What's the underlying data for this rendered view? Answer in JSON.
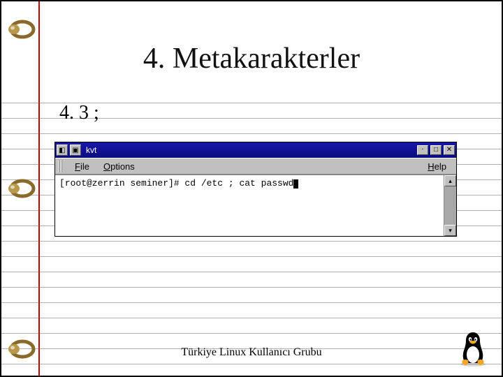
{
  "slide": {
    "title": "4. Metakarakterler",
    "section": "4. 3 ;",
    "footer": "Türkiye Linux Kullanıcı Grubu"
  },
  "terminal": {
    "window_title": "kvt",
    "menu": {
      "file": "File",
      "options": "Options",
      "help": "Help"
    },
    "prompt_line": "[root@zerrin seminer]# cd /etc ; cat passwd",
    "buttons": {
      "sysmenu": "▾",
      "iconify": "·",
      "maximize": "□",
      "close": "✕",
      "scroll_up": "▴",
      "scroll_down": "▾"
    }
  }
}
